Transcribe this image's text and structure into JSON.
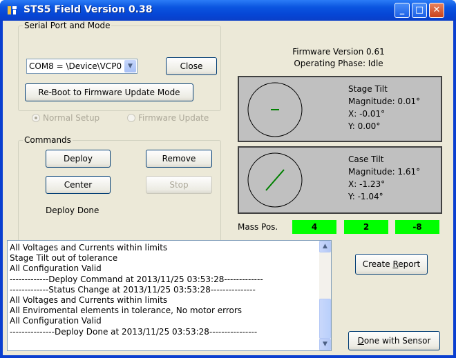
{
  "window": {
    "title": "STS5 Field Version 0.38",
    "minimize": "_",
    "maximize": "□",
    "close": "✕"
  },
  "serial": {
    "legend": "Serial Port and Mode",
    "port_value": "COM8 = \\Device\\VCP0",
    "close_label": "Close",
    "reboot_label": "Re-Boot to Firmware Update Mode",
    "radio_normal": "Normal Setup",
    "radio_firmware": "Firmware Update"
  },
  "commands": {
    "legend": "Commands",
    "deploy": "Deploy",
    "remove": "Remove",
    "center": "Center",
    "stop": "Stop",
    "status": "Deploy  Done"
  },
  "status": {
    "firmware": "Firmware Version 0.61",
    "phase": "Operating Phase: Idle"
  },
  "stage_tilt": {
    "title": "Stage Tilt",
    "magnitude": "Magnitude: 0.01°",
    "x": "X: -0.01°",
    "y": "Y: 0.00°",
    "indicator_angle_deg": 0
  },
  "case_tilt": {
    "title": "Case Tilt",
    "magnitude": "Magnitude: 1.61°",
    "x": "X: -1.23°",
    "y": "Y: -1.04°",
    "indicator_angle_deg": -40
  },
  "mass": {
    "label": "Mass Pos.",
    "values": [
      "4",
      "2",
      "-8"
    ],
    "color": "#00ff00"
  },
  "log": {
    "lines": [
      "All Voltages and Currents within limits",
      "Stage Tilt out of tolerance",
      "All Configuration Valid",
      "-------------Deploy Command at 2013/11/25 03:53:28-------------",
      "-------------Status Change at 2013/11/25 03:53:28---------------",
      "All Voltages and Currents within limits",
      "All Enviromental elements in tolerance, No motor errors",
      "All Configuration Valid",
      "---------------Deploy Done at 2013/11/25 03:53:28----------------"
    ]
  },
  "actions": {
    "create_report_pre": "Create ",
    "create_report_ul": "R",
    "create_report_post": "eport",
    "done_ul": "D",
    "done_post": "one with Sensor"
  },
  "colors": {
    "titlebar": "#0b55e0",
    "dialog_bg": "#ece9d8",
    "tilt_panel": "#c0c0c0",
    "indicator": "#008000"
  }
}
